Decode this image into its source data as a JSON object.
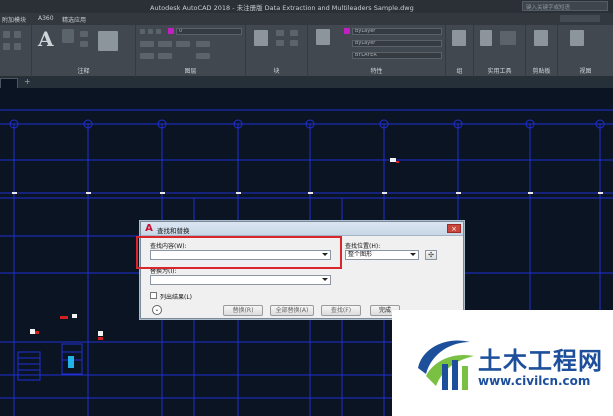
{
  "window": {
    "title": "Autodesk AutoCAD 2018 - 未注册版    Data Extraction and Multileaders Sample.dwg",
    "search_placeholder": "键入关键字或短语"
  },
  "tabs": [
    "附加模块",
    "A360",
    "精选应用"
  ],
  "ribbon": {
    "panels": [
      "注释",
      "图层",
      "块",
      "特性",
      "组",
      "实用工具",
      "剪贴板",
      "视图"
    ],
    "layer_combo_value": "0",
    "bylayer_color": "ByLayer",
    "bylayer_linetype": "ByLayer",
    "bylayer_lineweight": "BYLAYER"
  },
  "dialog": {
    "title": "查找和替换",
    "find_label": "查找内容(W):",
    "find_value": "",
    "location_label": "查找位置(H):",
    "location_value": "整个图形",
    "replace_label": "替换为(I):",
    "replace_value": "",
    "list_results_label": "列出结果(L)",
    "buttons": {
      "replace": "替换(R)",
      "replace_all": "全部替换(A)",
      "find": "查找(F)",
      "done": "完成"
    },
    "expand_symbol": "⌄"
  },
  "watermark": {
    "brand": "土木工程网",
    "url": "www.civilcn.com"
  },
  "colors": {
    "drawing_bg": "#0b1422",
    "grid_lines": "#1f2fd6",
    "highlight": "#d9262c",
    "brand_blue": "#1d4f9b",
    "brand_green": "#7ac143"
  }
}
